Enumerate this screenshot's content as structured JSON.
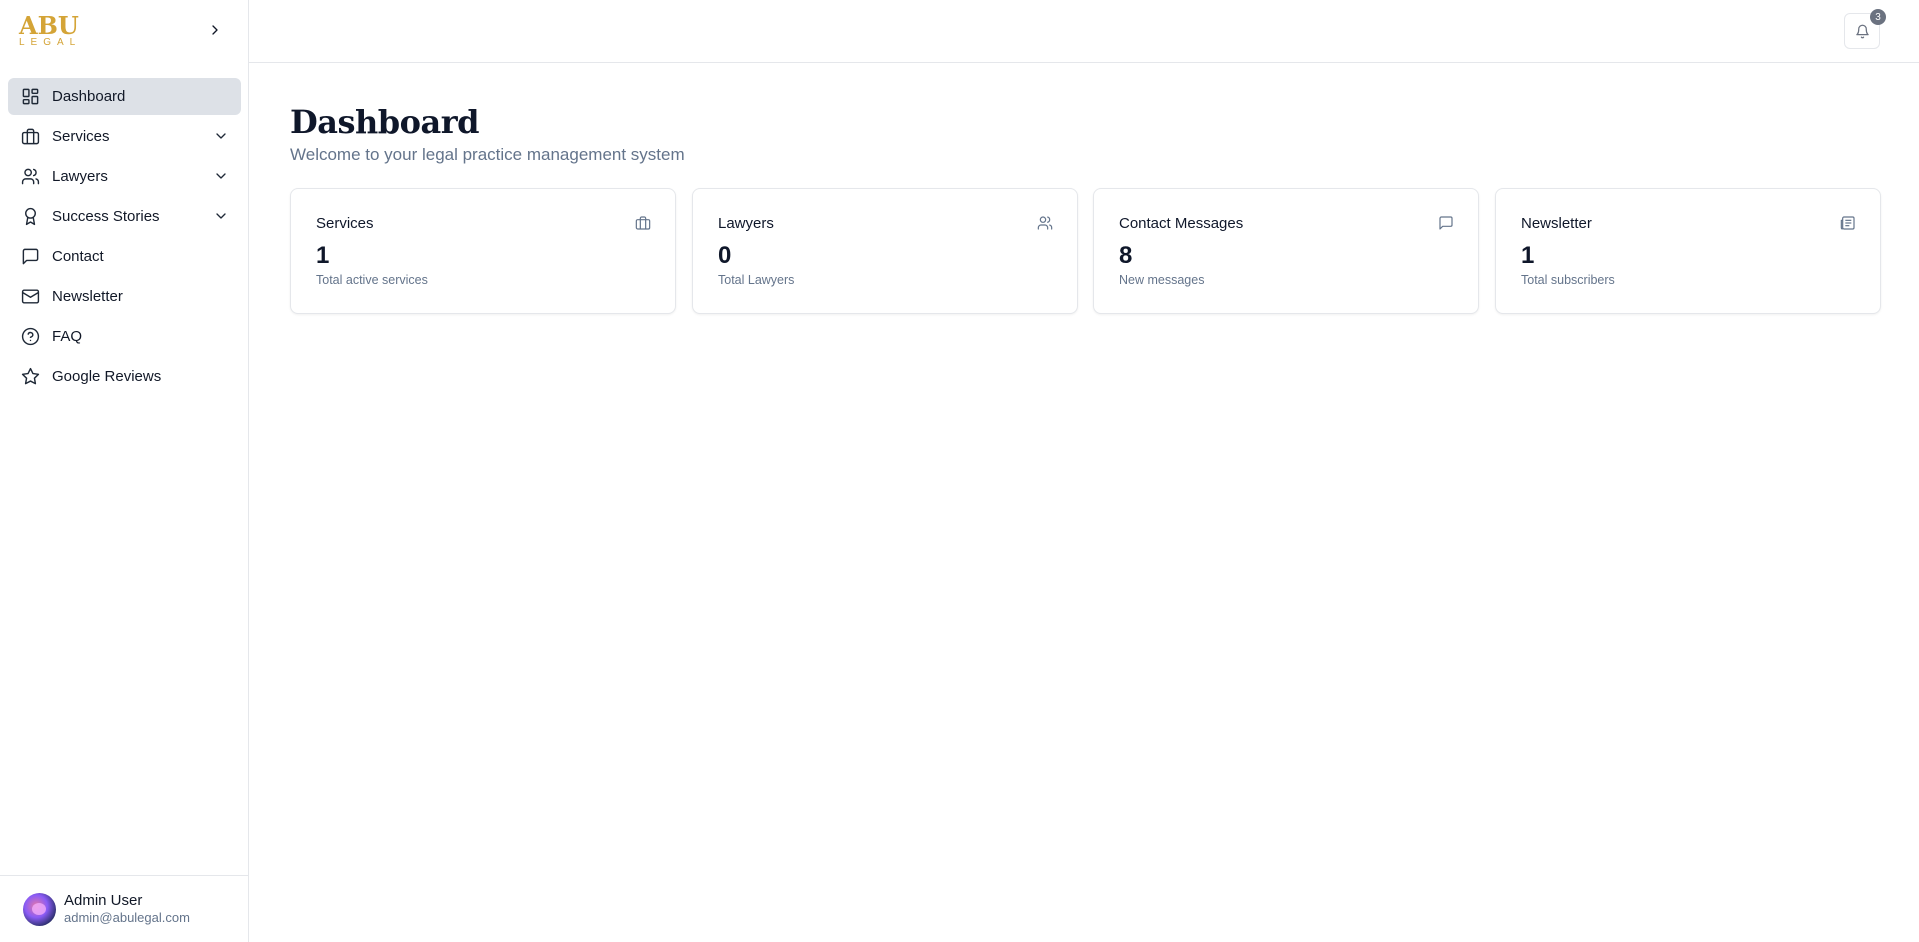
{
  "logo": {
    "top": "ABU",
    "bottom": "LEGAL"
  },
  "sidebar": {
    "items": [
      {
        "label": "Dashboard",
        "icon": "dashboard-icon",
        "active": true,
        "expandable": false
      },
      {
        "label": "Services",
        "icon": "briefcase-icon",
        "active": false,
        "expandable": true
      },
      {
        "label": "Lawyers",
        "icon": "users-icon",
        "active": false,
        "expandable": true
      },
      {
        "label": "Success Stories",
        "icon": "award-icon",
        "active": false,
        "expandable": true
      },
      {
        "label": "Contact",
        "icon": "message-icon",
        "active": false,
        "expandable": false
      },
      {
        "label": "Newsletter",
        "icon": "mail-icon",
        "active": false,
        "expandable": false
      },
      {
        "label": "FAQ",
        "icon": "help-circle-icon",
        "active": false,
        "expandable": false
      },
      {
        "label": "Google Reviews",
        "icon": "star-icon",
        "active": false,
        "expandable": false
      }
    ]
  },
  "user": {
    "name": "Admin User",
    "email": "admin@abulegal.com"
  },
  "topbar": {
    "notification_count": "3"
  },
  "main": {
    "title": "Dashboard",
    "subtitle": "Welcome to your legal practice management system",
    "cards": [
      {
        "title": "Services",
        "value": "1",
        "desc": "Total active services",
        "icon": "briefcase-icon"
      },
      {
        "title": "Lawyers",
        "value": "0",
        "desc": "Total Lawyers",
        "icon": "users-icon"
      },
      {
        "title": "Contact Messages",
        "value": "8",
        "desc": "New messages",
        "icon": "message-icon"
      },
      {
        "title": "Newsletter",
        "value": "1",
        "desc": "Total subscribers",
        "icon": "newspaper-icon"
      }
    ]
  },
  "colors": {
    "brand_gold": "#d4a437",
    "active_bg": "#dde1e7",
    "muted_text": "#64748b"
  }
}
